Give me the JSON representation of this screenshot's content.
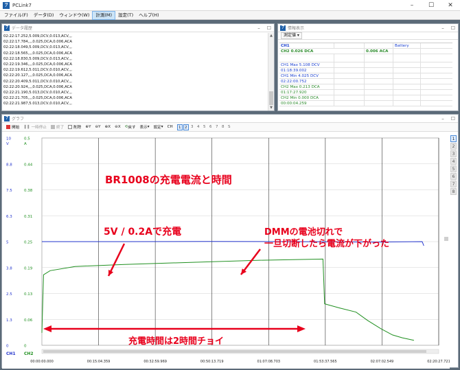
{
  "app": {
    "title": "PCLink7"
  },
  "menu": [
    "ファイル(F)",
    "データ(D)",
    "ウィンドウ(W)",
    "計測(M)",
    "設定(T)",
    "ヘルプ(H)"
  ],
  "menu_active_index": 3,
  "history": {
    "title": "データ履歴",
    "lines": [
      "02:22:17.252,5.009,DCV,0.013,ACV,,,",
      "02:22:17.784,,,,0.025,DCA,0.006,ACA",
      "02:22:18.049,5.009,DCV,0.013,ACV,,,",
      "02:22:18.565,,,,0.025,DCA,0.006,ACA",
      "02:22:18.830,5.009,DCV,0.013,ACV,,,",
      "02:22:19.346,,,,0.025,DCA,0.006,ACA",
      "02:22:19.612,5.011,DCV,0.010,ACV,,,",
      "02:22:20.127,,,,0.025,DCA,0.006,ACA",
      "02:22:20.409,5.011,DCV,0.010,ACV,,,",
      "02:22:20.924,,,,0.025,DCA,0.006,ACA",
      "02:22:21.190,5.013,DCV,0.010,ACV,,,",
      "02:22:21.705,,,,0.025,DCA,0.006,ACA",
      "02:22:21.987,5.013,DCV,0.010,ACV,,,"
    ]
  },
  "info": {
    "title": "情報表示",
    "button": "測定値",
    "header_row": [
      "CH1",
      "",
      "",
      "Battery",
      ""
    ],
    "ch2_row": [
      "CH2  0.026  DCA",
      "",
      "0.006  ACA",
      "",
      ""
    ],
    "stats": [
      {
        "text": "CH1 Max 5.108 DCV",
        "color": "blue"
      },
      {
        "text": "01:18:39.002",
        "color": "blue"
      },
      {
        "text": "CH1 Min 4.025 DCV",
        "color": "blue"
      },
      {
        "text": "02:22:00.752",
        "color": "blue"
      },
      {
        "text": "CH2 Max 0.213 DCA",
        "color": "green"
      },
      {
        "text": "01:17:27.920",
        "color": "green"
      },
      {
        "text": "CH2 Min 0.000 DCA",
        "color": "green"
      },
      {
        "text": "00:00:04.259",
        "color": "green"
      }
    ]
  },
  "graph": {
    "title": "グラフ",
    "toolbar": {
      "start": "開始",
      "pause": "一時停止",
      "end": "終了",
      "delete": "削除",
      "zoom_y_in": "Y",
      "zoom_y_out": "Y",
      "zoom_x_in": "X",
      "zoom_x_out": "X",
      "back": "戻す",
      "display": "表示",
      "settings": "設定",
      "ch_label": "CH",
      "pages": [
        "1",
        "2",
        "3",
        "4",
        "5",
        "6",
        "7",
        "8",
        "S"
      ],
      "selected_pages": [
        "1",
        "2"
      ]
    },
    "right_tabs": [
      "1",
      "2",
      "3",
      "4",
      "5",
      "6",
      "7",
      "8"
    ]
  },
  "chart_data": {
    "type": "line",
    "x_ticks": [
      "00:00:00.000",
      "00:15:04.359",
      "00:32:59.969",
      "00:50:13.719",
      "01:07:08.703",
      "01:53:37.565",
      "02:07:02.549",
      "02:20:27.721"
    ],
    "y_left_unit": "V",
    "y_left_ticks": [
      "10",
      "8.8",
      "7.5",
      "6.3",
      "5",
      "3.8",
      "2.5",
      "1.3",
      "0"
    ],
    "y_right_unit": "A",
    "y_right_ticks": [
      "0.5",
      "0.44",
      "0.38",
      "0.31",
      "0.25",
      "0.19",
      "0.13",
      "0.06",
      "0"
    ],
    "axis_labels_bottom": [
      "CH1",
      "CH2"
    ],
    "x_range_hours": [
      0,
      2.4
    ],
    "series": [
      {
        "color": "#2233cc",
        "axis": "left",
        "points": [
          [
            0,
            5.0
          ],
          [
            0.5,
            5.0
          ],
          [
            1.0,
            5.01
          ],
          [
            1.5,
            5.0
          ],
          [
            2.0,
            4.98
          ],
          [
            2.3,
            5.0
          ],
          [
            2.31,
            4.8
          ]
        ]
      },
      {
        "color": "#1f8f1f",
        "axis": "right",
        "points": [
          [
            0,
            0.03
          ],
          [
            0.01,
            0.17
          ],
          [
            0.05,
            0.18
          ],
          [
            0.2,
            0.19
          ],
          [
            0.5,
            0.195
          ],
          [
            0.9,
            0.2
          ],
          [
            1.3,
            0.205
          ],
          [
            1.7,
            0.208
          ],
          [
            1.71,
            0.1
          ],
          [
            1.8,
            0.09
          ],
          [
            1.9,
            0.08
          ],
          [
            1.97,
            0.06
          ],
          [
            2.05,
            0.04
          ],
          [
            2.12,
            0.025
          ],
          [
            2.18,
            0.018
          ],
          [
            2.25,
            0.012
          ]
        ]
      }
    ],
    "annotations": [
      "BR1008の充電電流と時間",
      "5V / 0.2Aで充電",
      "DMMの電池切れで",
      "一旦切断したら電流が下がった",
      "充電時間は2時間チョイ"
    ]
  }
}
